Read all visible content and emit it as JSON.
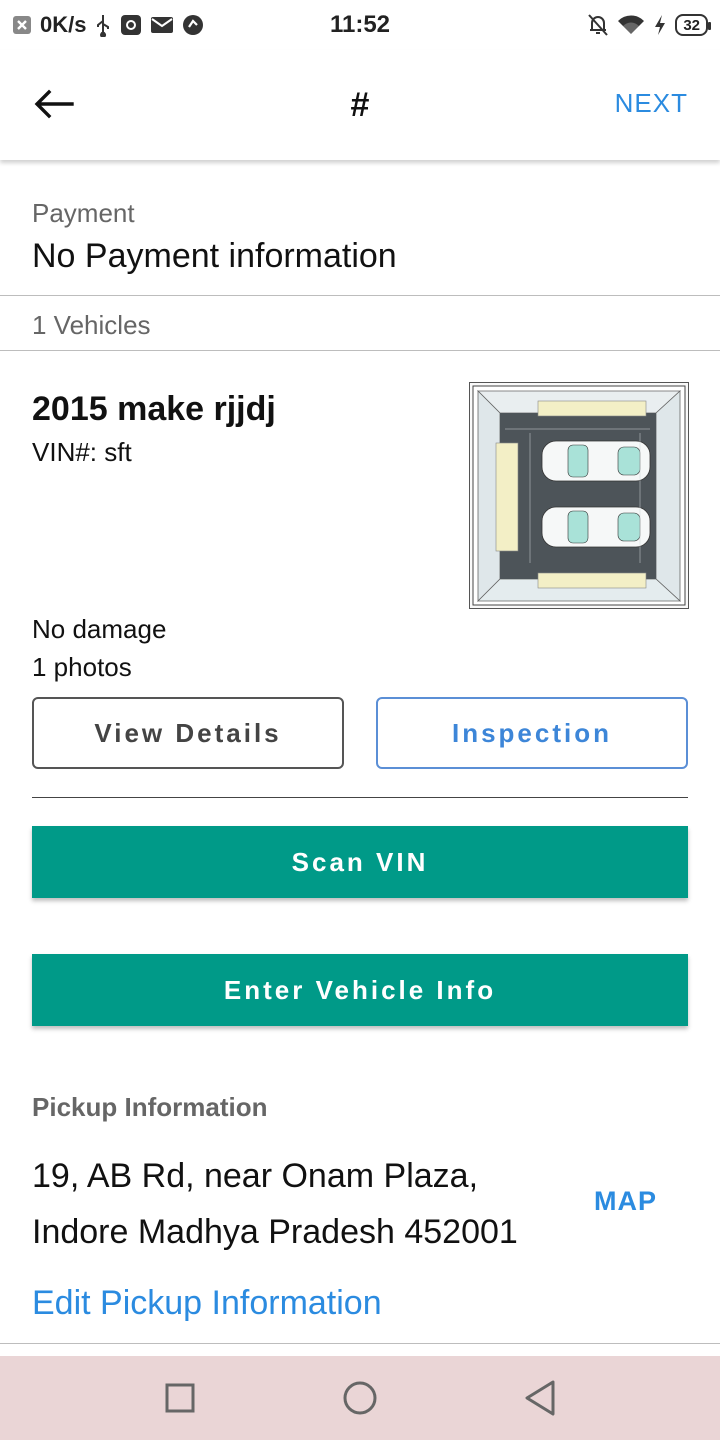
{
  "status_bar": {
    "net_speed": "0K/s",
    "time": "11:52",
    "battery": "32",
    "icons": [
      "blocked-icon",
      "usb-icon",
      "storage-icon",
      "mail-icon",
      "sync-icon",
      "bell-off-icon",
      "wifi-icon",
      "charging-icon",
      "battery-icon"
    ]
  },
  "app_bar": {
    "title": "#",
    "next_label": "NEXT",
    "icons": [
      "back-arrow-icon"
    ]
  },
  "payment": {
    "label": "Payment",
    "value": "No Payment information"
  },
  "vehicles": {
    "count_label": "1 Vehicles",
    "items": [
      {
        "name": "2015 make rjjdj",
        "vin": "VIN#: sft",
        "damage": "No damage",
        "photos": "1 photos",
        "view_details_label": "View Details",
        "inspection_label": "Inspection"
      }
    ]
  },
  "actions": {
    "scan_vin_label": "Scan VIN",
    "enter_vehicle_label": "Enter Vehicle Info"
  },
  "pickup": {
    "label": "Pickup Information",
    "address_line1": "19, AB Rd, near Onam Plaza,",
    "address_line2": "Indore Madhya Pradesh 452001",
    "map_label": "MAP",
    "edit_label": "Edit Pickup Information"
  },
  "nav_bar": {
    "icons": [
      "recents-square-icon",
      "home-circle-icon",
      "back-triangle-icon"
    ]
  },
  "colors": {
    "accent_teal": "#009a88",
    "link_blue": "#2b8be0",
    "nav_background": "#ead5d6"
  }
}
